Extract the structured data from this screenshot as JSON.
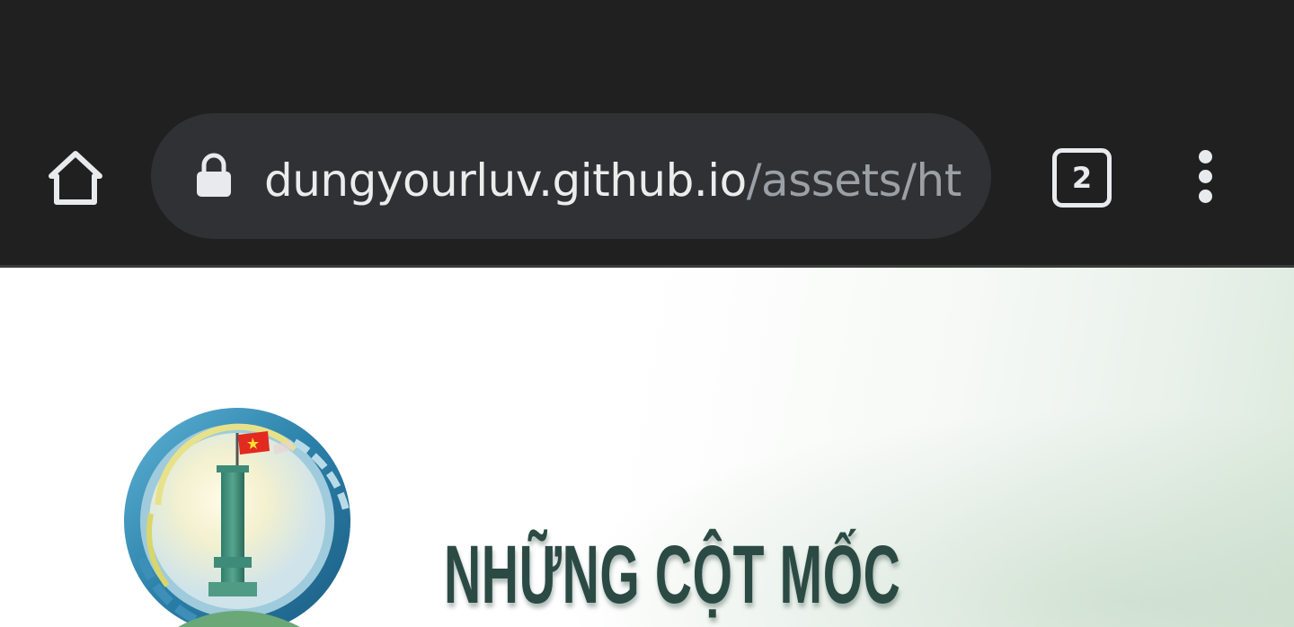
{
  "browser": {
    "url_domain": "dungyourluv.github.io",
    "url_path": "/assets/ht",
    "tab_count": "2",
    "icons": {
      "home": "home-icon",
      "lock": "lock-icon",
      "tabs": "tab-switcher-icon",
      "menu": "more-vert-icon"
    },
    "colors": {
      "toolbar_background": "#202020",
      "omnibox_background": "#303134",
      "url_domain": "#ececec",
      "url_path": "#9aa0a6"
    }
  },
  "page": {
    "heading": "NHỮNG CỘT MỐC",
    "logo_icon": "border-marker-flag-logo",
    "colors": {
      "heading": "#2c4a44",
      "background": "#ffffff"
    }
  }
}
